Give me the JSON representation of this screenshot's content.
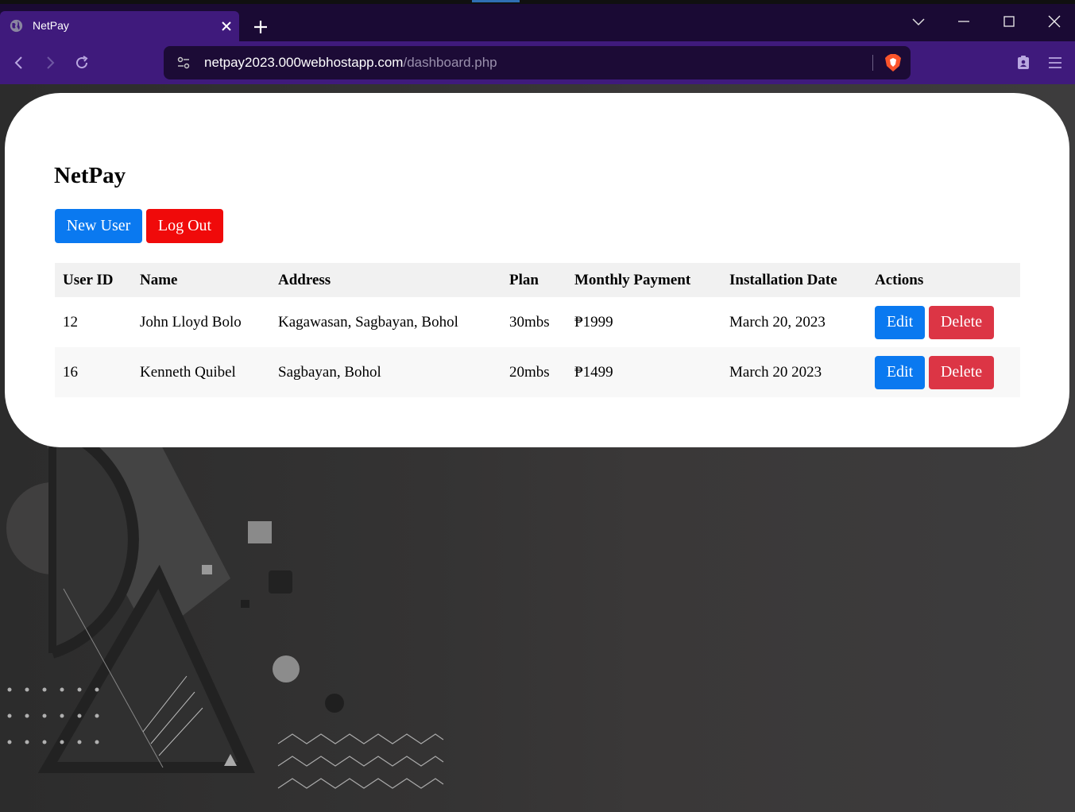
{
  "browser": {
    "tab_title": "NetPay",
    "url_host": "netpay2023.000webhostapp.com",
    "url_path": "/dashboard.php",
    "theme_color": "#3f1a7c"
  },
  "page": {
    "title": "NetPay",
    "buttons": {
      "new_user": "New User",
      "log_out": "Log Out"
    },
    "table": {
      "headers": [
        "User ID",
        "Name",
        "Address",
        "Plan",
        "Monthly Payment",
        "Installation Date",
        "Actions"
      ],
      "rows": [
        {
          "user_id": "12",
          "name": "John Lloyd Bolo",
          "address": "Kagawasan, Sagbayan, Bohol",
          "plan": "30mbs",
          "payment": "₱1999",
          "date": "March 20, 2023"
        },
        {
          "user_id": "16",
          "name": "Kenneth Quibel",
          "address": "Sagbayan, Bohol",
          "plan": "20mbs",
          "payment": "₱1499",
          "date": "March 20 2023"
        }
      ],
      "action_labels": {
        "edit": "Edit",
        "delete": "Delete"
      }
    },
    "colors": {
      "primary": "#0a79f0",
      "logout": "#f00a0a",
      "delete": "#dc3545"
    }
  }
}
